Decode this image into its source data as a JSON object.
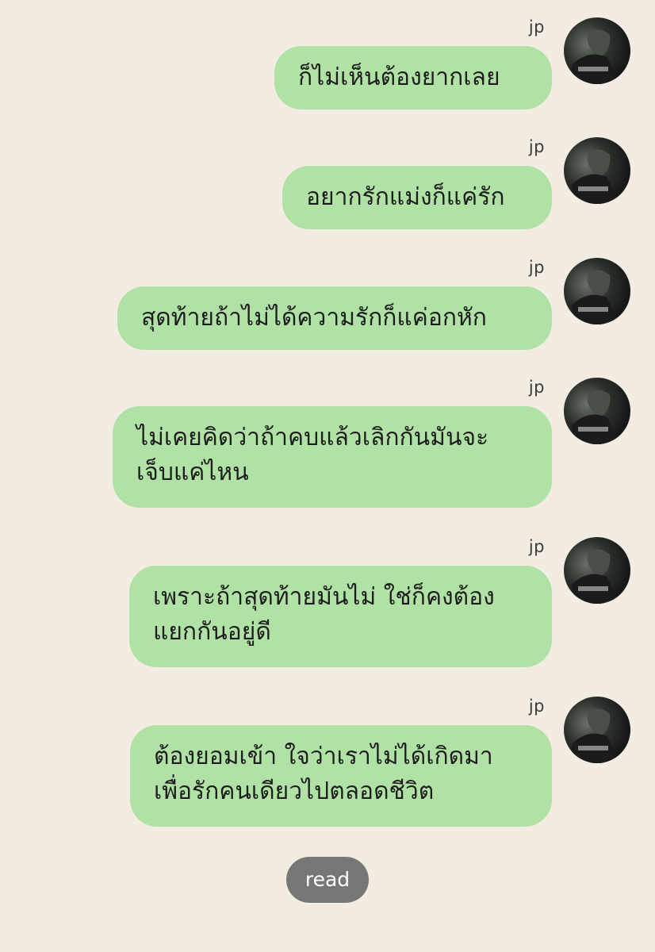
{
  "messages": [
    {
      "sender": "jp",
      "lines": [
        "ก็ไม่เห็นต้องยากเลย"
      ]
    },
    {
      "sender": "jp",
      "lines": [
        "อยากรักแม่งก็แค่รัก"
      ]
    },
    {
      "sender": "jp",
      "lines": [
        "สุดท้ายถ้าไม่ได้ความรักก็แค่อกหัก"
      ]
    },
    {
      "sender": "jp",
      "lines": [
        "ไม่เคยคิดว่าถ้าคบแล้วเลิกกันมันจะ",
        "เจ็บแค่ไหน"
      ]
    },
    {
      "sender": "jp",
      "lines": [
        "เพราะถ้าสุดท้ายมันไม่ ใช่ก็คงต้อง",
        "แยกกันอยู่ดี"
      ]
    },
    {
      "sender": "jp",
      "lines": [
        "ต้องยอมเข้า ใจว่าเราไม่ได้เกิดมา",
        "เพื่อรักคนเดียวไปตลอดชีวิต"
      ]
    }
  ],
  "read_status": "read",
  "colors": {
    "background": "#f2ece2",
    "bubble": "#b0e2a6",
    "read_pill": "#777777"
  },
  "icons": {
    "avatar": "profile-photo"
  }
}
